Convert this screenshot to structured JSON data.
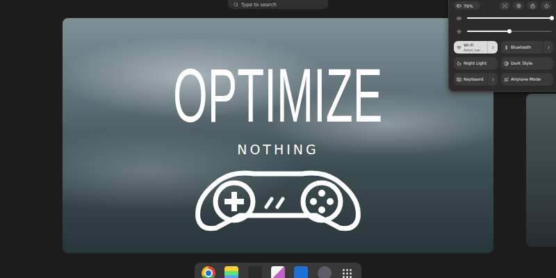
{
  "search": {
    "placeholder": "Type to search"
  },
  "workspace": {
    "overlay": {
      "title": "OPTIMIZE",
      "subtitle": "NOTHING"
    }
  },
  "quick_settings": {
    "battery": "79%",
    "sliders": [
      {
        "kind": "volume",
        "level": 1.0
      },
      {
        "kind": "brightness",
        "level": 0.5
      }
    ],
    "tiles": [
      {
        "label": "Wi-Fi",
        "subtitle": "Airtel_har…",
        "on": true,
        "has_menu": true
      },
      {
        "label": "Bluetooth",
        "on": false,
        "has_menu": true
      },
      {
        "label": "Night Light",
        "on": false,
        "has_menu": false
      },
      {
        "label": "Dark Style",
        "on": false,
        "has_menu": false
      },
      {
        "label": "Keyboard",
        "on": false,
        "has_menu": true
      },
      {
        "label": "Airplane Mode",
        "on": false,
        "has_menu": false
      }
    ]
  }
}
